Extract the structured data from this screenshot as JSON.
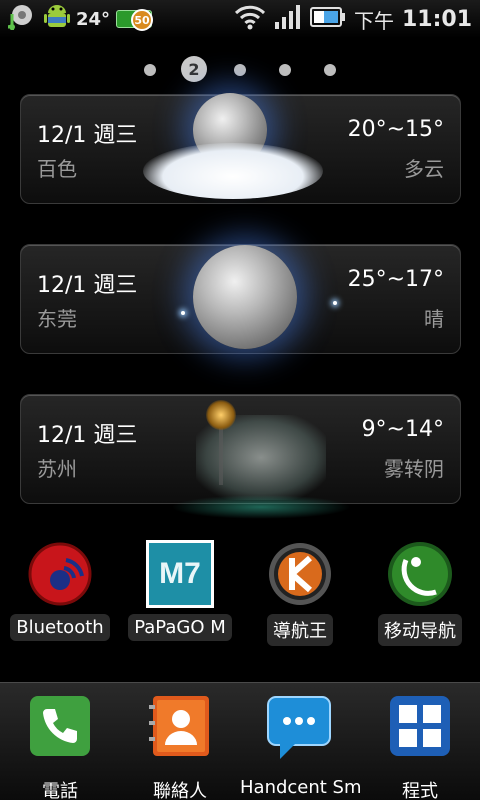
{
  "status_bar": {
    "temperature": "24°",
    "battery_badge": "50",
    "time_prefix": "下午",
    "time": "11:01"
  },
  "home": {
    "active_page": "2",
    "page_count": 5
  },
  "weather_cards": [
    {
      "date": "12/1 週三",
      "temp": "20°~15°",
      "city": "百色",
      "condition": "多云"
    },
    {
      "date": "12/1 週三",
      "temp": "25°~17°",
      "city": "东莞",
      "condition": "晴"
    },
    {
      "date": "12/1 週三",
      "temp": "9°~14°",
      "city": "苏州",
      "condition": "雾转阴"
    }
  ],
  "apps": [
    {
      "label": "Bluetooth"
    },
    {
      "label": "PaPaGO M",
      "icon_text": "M7"
    },
    {
      "label": "導航王"
    },
    {
      "label": "移动导航"
    }
  ],
  "dock": [
    {
      "label": "電話"
    },
    {
      "label": "聯絡人"
    },
    {
      "label": "Handcent Sm"
    },
    {
      "label": "程式"
    }
  ]
}
